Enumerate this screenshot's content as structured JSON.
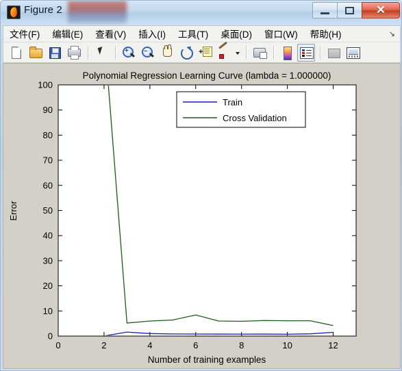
{
  "window": {
    "title": "Figure 2",
    "app_icon": "matlab-flame-icon",
    "controls": {
      "minimize": "–",
      "maximize": "❐",
      "close": "✕"
    }
  },
  "menubar": {
    "items": [
      {
        "label": "文件(F)",
        "name": "menu-file"
      },
      {
        "label": "编辑(E)",
        "name": "menu-edit"
      },
      {
        "label": "查看(V)",
        "name": "menu-view"
      },
      {
        "label": "插入(I)",
        "name": "menu-insert"
      },
      {
        "label": "工具(T)",
        "name": "menu-tools"
      },
      {
        "label": "桌面(D)",
        "name": "menu-desktop"
      },
      {
        "label": "窗口(W)",
        "name": "menu-window"
      },
      {
        "label": "帮助(H)",
        "name": "menu-help"
      }
    ],
    "overflow_glyph": "↘"
  },
  "toolbar": {
    "buttons": [
      {
        "icon": "new-figure-icon"
      },
      {
        "icon": "open-file-icon"
      },
      {
        "icon": "save-figure-icon"
      },
      {
        "icon": "print-figure-icon"
      },
      {
        "icon": "edit-plot-arrow-icon"
      },
      {
        "icon": "zoom-in-icon"
      },
      {
        "icon": "zoom-out-icon"
      },
      {
        "icon": "pan-icon"
      },
      {
        "icon": "rotate-3d-icon"
      },
      {
        "icon": "insert-data-tip-icon"
      },
      {
        "icon": "brush-data-icon"
      },
      {
        "icon": "print-preview-icon"
      },
      {
        "icon": "colorbar-icon"
      },
      {
        "icon": "legend-icon"
      },
      {
        "icon": "hide-plot-tools-icon"
      },
      {
        "icon": "show-plot-tools-icon"
      }
    ]
  },
  "chart_data": {
    "type": "line",
    "title": "Polynomial Regression Learning Curve (lambda = 1.000000)",
    "xlabel": "Number of training examples",
    "ylabel": "Error",
    "xlim": [
      0,
      13
    ],
    "ylim": [
      0,
      100
    ],
    "xticks": [
      0,
      2,
      4,
      6,
      8,
      10,
      12
    ],
    "yticks": [
      0,
      10,
      20,
      30,
      40,
      50,
      60,
      70,
      80,
      90,
      100
    ],
    "grid": false,
    "legend_position": "upper right",
    "x": [
      1,
      2,
      3,
      4,
      5,
      6,
      7,
      8,
      9,
      10,
      11,
      12
    ],
    "series": [
      {
        "name": "Train",
        "color": "#1a1ab4",
        "values": [
          0.0,
          0.05,
          1.6,
          1.0,
          0.85,
          0.82,
          0.8,
          0.78,
          0.8,
          0.75,
          0.9,
          1.5
        ]
      },
      {
        "name": "Cross Validation",
        "color": "#1a5c1a",
        "values": [
          160.0,
          122.0,
          5.2,
          6.0,
          6.4,
          8.4,
          6.0,
          5.9,
          6.2,
          6.1,
          6.1,
          4.2
        ]
      }
    ]
  }
}
